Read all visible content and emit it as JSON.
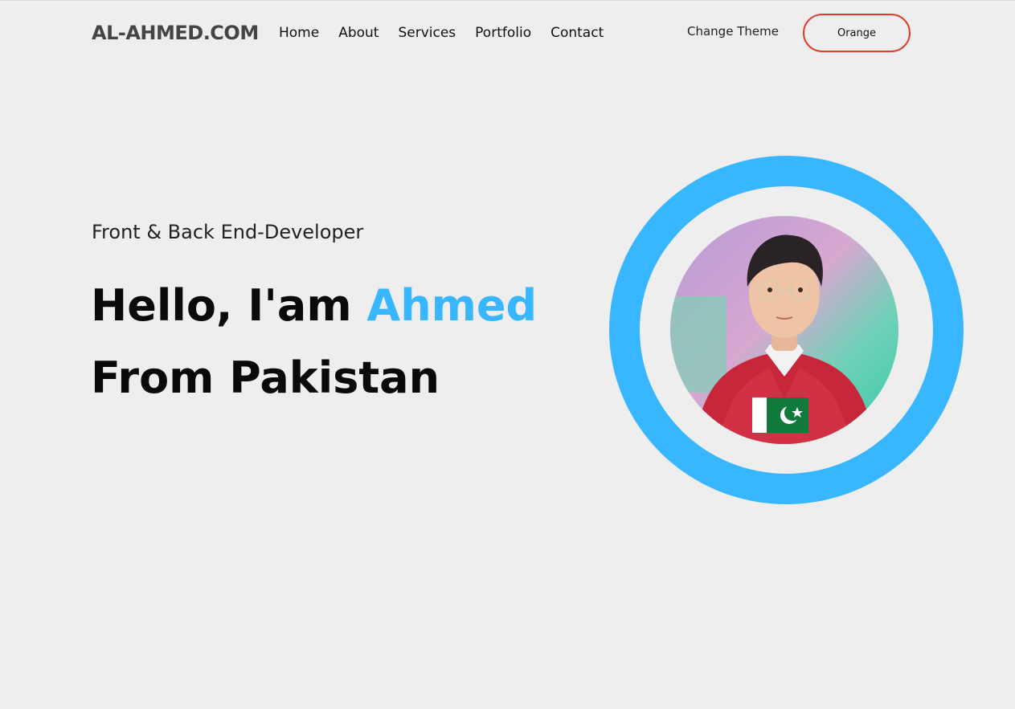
{
  "brand": {
    "logo": "AL-AHMED.COM"
  },
  "nav": {
    "items": [
      {
        "label": "Home"
      },
      {
        "label": "About"
      },
      {
        "label": "Services"
      },
      {
        "label": "Portfolio"
      },
      {
        "label": "Contact"
      }
    ]
  },
  "theme": {
    "label": "Change Theme",
    "current": "Orange",
    "button_border_color": "#e33c2f"
  },
  "hero": {
    "subtitle": "Front & Back End-Developer",
    "greeting": "Hello, I'am",
    "name": "Ahmed",
    "line2": "From Pakistan",
    "accent_color": "#38b6ff"
  },
  "avatar": {
    "icon": "profile-portrait",
    "ring_color": "#38b6ff"
  }
}
